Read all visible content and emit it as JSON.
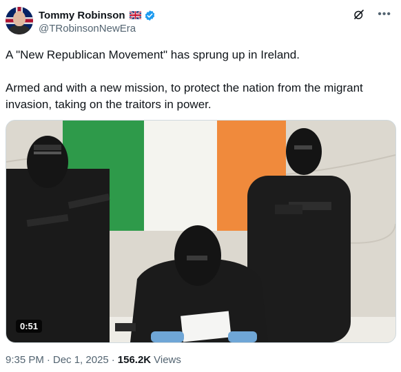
{
  "author": {
    "name": "Tommy Robinson",
    "handle": "@TRobinsonNewEra",
    "verified_color": "#1d9bf0"
  },
  "tweet": {
    "paragraphs": [
      "A \"New Republican Movement\" has sprung up in Ireland.",
      "Armed and with a new mission, to protect the nation from the migrant invasion, taking on the traitors in power."
    ]
  },
  "media": {
    "duration": "0:51",
    "flag_colors": [
      "#2e9a4a",
      "#f4f4ef",
      "#f08a3c"
    ]
  },
  "meta": {
    "time": "9:35 PM",
    "separator": "·",
    "date": "Dec 1, 2025",
    "views_count": "156.2K",
    "views_label": "Views"
  },
  "icons": {
    "grok": "grok-icon",
    "more": "more-icon",
    "verified": "verified-badge-icon",
    "flag": "uk-flag-icon"
  }
}
